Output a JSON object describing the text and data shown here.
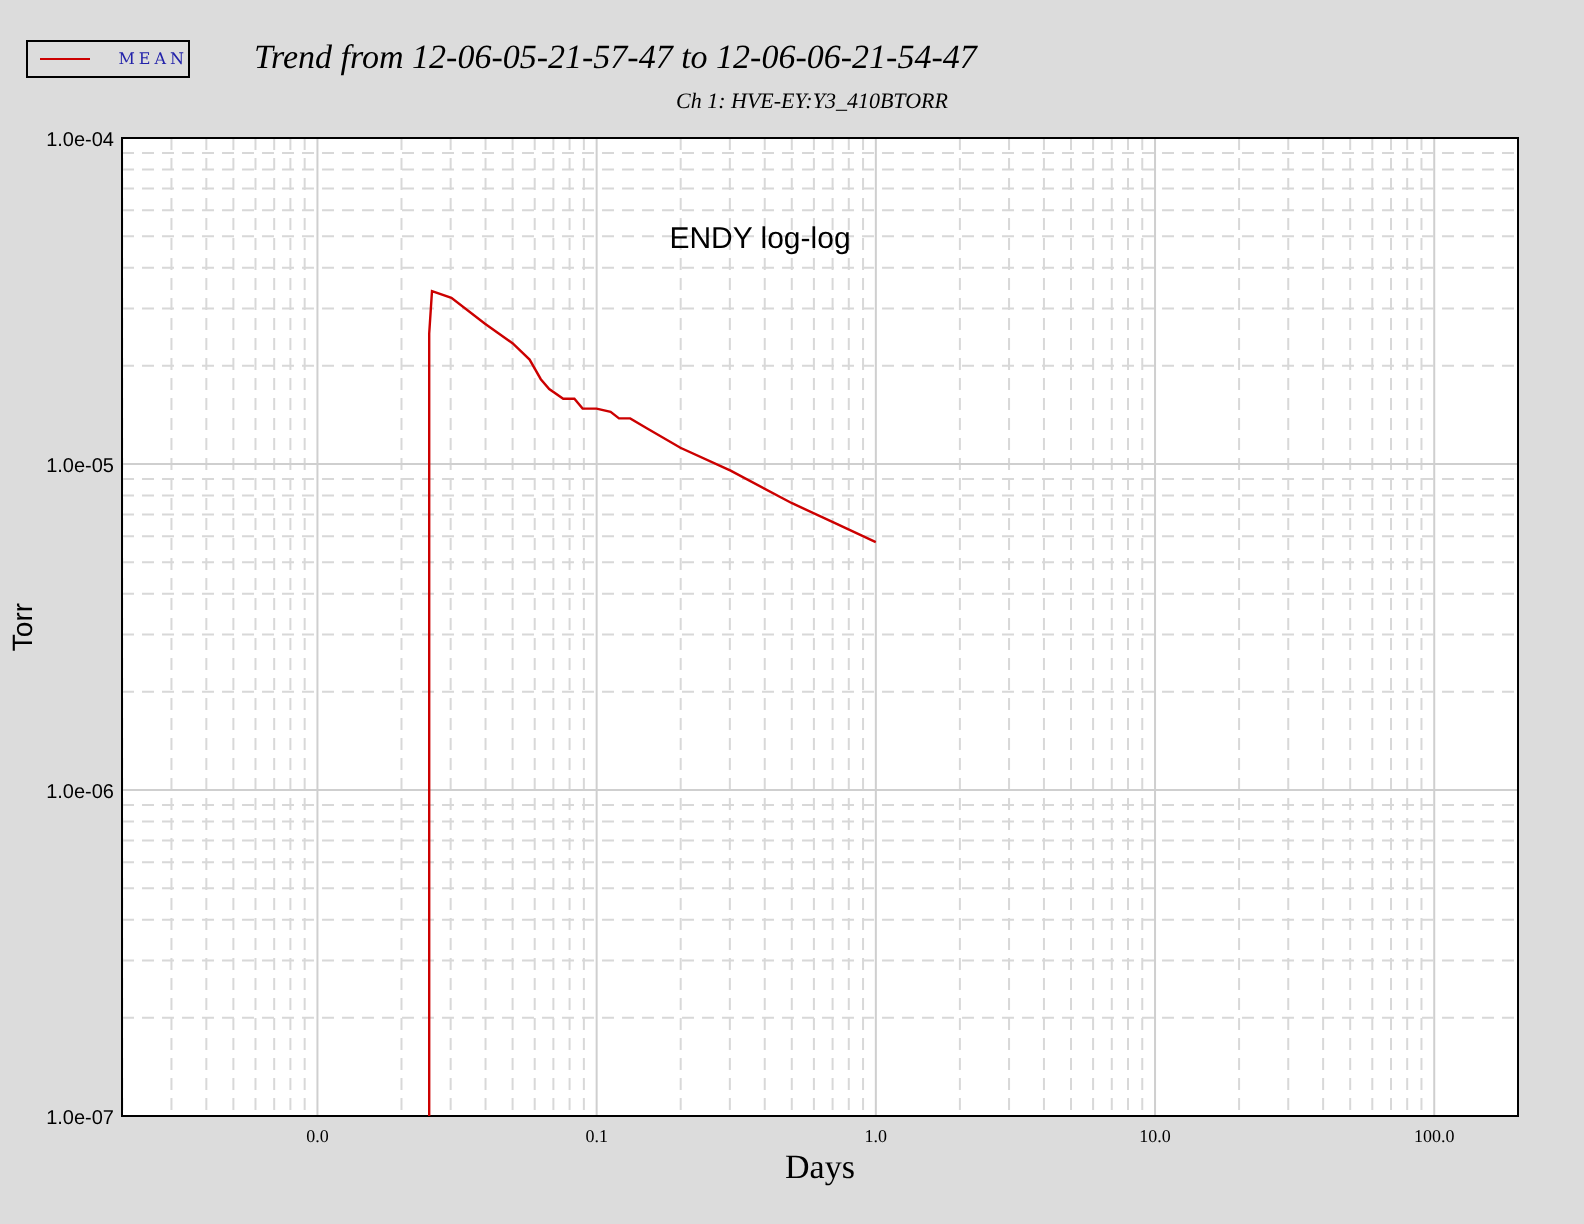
{
  "header": {
    "title": "Trend from 12-06-05-21-57-47 to 12-06-06-21-54-47",
    "subtitle": "Ch 1: HVE-EY:Y3_410BTORR"
  },
  "legend": [
    {
      "label": "MEAN",
      "color": "#cc0000"
    }
  ],
  "plot": {
    "annotation": "ENDY log-log",
    "x_axis_title": "Days",
    "y_axis_title": "Torr",
    "x_tick_labels": [
      "0.0",
      "0.1",
      "1.0",
      "10.0",
      "100.0"
    ],
    "y_tick_labels": [
      "1.0e-04",
      "1.0e-05",
      "1.0e-06",
      "1.0e-07"
    ]
  }
}
